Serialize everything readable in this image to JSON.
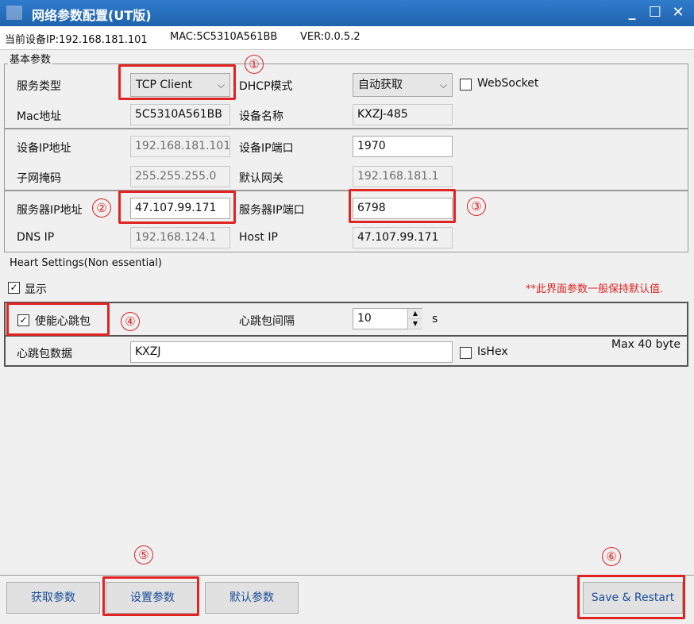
{
  "window": {
    "title": "网络参数配置(UT版)",
    "controls": [
      "_",
      "☐",
      "✕"
    ]
  },
  "info": {
    "ip": "当前设备IP:192.168.181.101",
    "mac": "MAC:5C5310A561BB",
    "ver": "VER:0.0.5.2"
  },
  "basic": {
    "group_title": "基本参数",
    "service_type_label": "服务类型",
    "service_type_value": "TCP Client",
    "dhcp_label": "DHCP模式",
    "dhcp_value": "自动获取",
    "websocket_label": "WebSocket",
    "mac_label": "Mac地址",
    "mac_value": "5C5310A561BB",
    "device_name_label": "设备名称",
    "device_name_value": "KXZJ-485",
    "device_ip_label": "设备IP地址",
    "device_ip_value": "192.168.181.101",
    "device_port_label": "设备IP端口",
    "device_port_value": "1970",
    "subnet_label": "子网掩码",
    "subnet_value": "255.255.255.0",
    "gateway_label": "默认网关",
    "gateway_value": "192.168.181.1",
    "server_ip_label": "服务器IP地址",
    "server_ip_value": "47.107.99.171",
    "server_port_label": "服务器IP端口",
    "server_port_value": "6798",
    "dns_label": "DNS IP",
    "dns_value": "192.168.124.1",
    "host_label": "Host IP",
    "host_value": "47.107.99.171"
  },
  "heart": {
    "group_title": "Heart Settings(Non essential)",
    "show_label": "显示",
    "note": "**此界面参数一般保持默认值.",
    "enable_label": "使能心跳包",
    "interval_label": "心跳包间隔",
    "interval_value": "10",
    "interval_unit": "s",
    "data_label": "心跳包数据",
    "data_value": "KXZJ",
    "ishex_label": "IsHex",
    "max_label": "Max 40 byte"
  },
  "buttons": {
    "get": "获取参数",
    "set": "设置参数",
    "default": "默认参数",
    "save": "Save & Restart"
  },
  "markers": [
    "①",
    "②",
    "③",
    "④",
    "⑤",
    "⑥"
  ],
  "colors": {
    "title_bar": "#1f63ad",
    "marker": "#e02424",
    "button_text": "#1a4f99"
  }
}
